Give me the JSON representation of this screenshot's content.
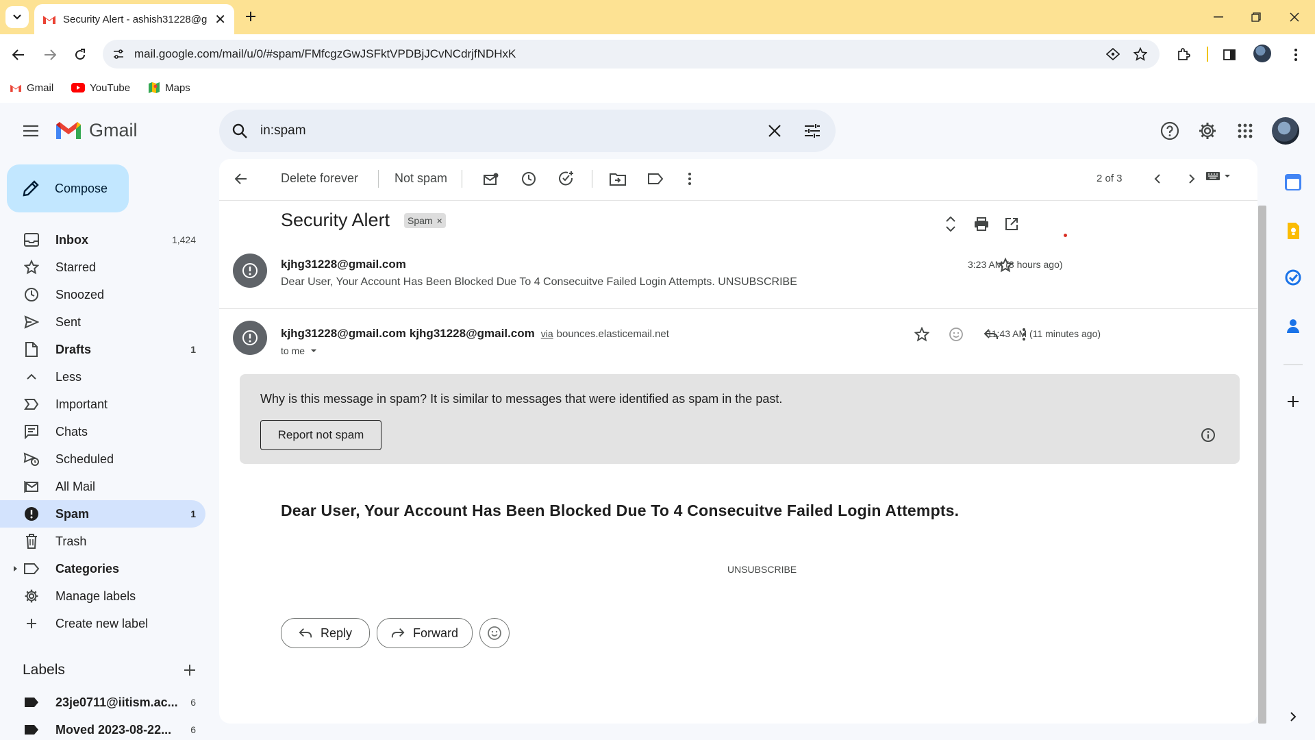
{
  "browser": {
    "tab_title": "Security Alert - ashish31228@g",
    "url": "mail.google.com/mail/u/0/#spam/FMfcgzGwJSFktVPDBjJCvNCdrjfNDHxK",
    "bookmarks": [
      "Gmail",
      "YouTube",
      "Maps"
    ]
  },
  "gmail": {
    "logo_text": "Gmail",
    "search_value": "in:spam",
    "compose_label": "Compose",
    "nav": [
      {
        "label": "Inbox",
        "count": "1,424"
      },
      {
        "label": "Starred",
        "count": ""
      },
      {
        "label": "Snoozed",
        "count": ""
      },
      {
        "label": "Sent",
        "count": ""
      },
      {
        "label": "Drafts",
        "count": "1"
      },
      {
        "label": "Less",
        "count": ""
      },
      {
        "label": "Important",
        "count": ""
      },
      {
        "label": "Chats",
        "count": ""
      },
      {
        "label": "Scheduled",
        "count": ""
      },
      {
        "label": "All Mail",
        "count": ""
      },
      {
        "label": "Spam",
        "count": "1"
      },
      {
        "label": "Trash",
        "count": ""
      },
      {
        "label": "Categories",
        "count": ""
      },
      {
        "label": "Manage labels",
        "count": ""
      },
      {
        "label": "Create new label",
        "count": ""
      }
    ],
    "labels_heading": "Labels",
    "labels": [
      {
        "label": "23je0711@iitism.ac...",
        "count": "6"
      },
      {
        "label": "Moved 2023-08-22...",
        "count": "6"
      }
    ]
  },
  "toolbar": {
    "delete_forever": "Delete forever",
    "not_spam": "Not spam",
    "pagination": "2 of 3"
  },
  "thread": {
    "subject": "Security Alert",
    "spam_chip": "Spam",
    "chip_close": "×",
    "msg1": {
      "sender": "kjhg31228@gmail.com",
      "snippet": "Dear User, Your Account Has Been Blocked Due To 4 Consecuitve Failed Login Attempts. UNSUBSCRIBE",
      "time": "3:23 AM (8 hours ago)"
    },
    "msg2": {
      "sender_name": "kjhg31228@gmail.com",
      "sender_email": "kjhg31228@gmail.com",
      "via": "via",
      "via_domain": "bounces.elasticemail.net",
      "to": "to me",
      "time": "11:43 AM (11 minutes ago)"
    },
    "spam_notice": {
      "question": "Why is this message in spam?",
      "reason": "It is similar to messages that were identified as spam in the past.",
      "report_button": "Report not spam"
    },
    "body_heading": "Dear User, Your Account Has Been Blocked Due To 4 Consecuitve Failed Login Attempts.",
    "unsubscribe": "UNSUBSCRIBE",
    "reply_label": "Reply",
    "forward_label": "Forward"
  },
  "colors": {
    "tabstrip": "#fde293",
    "active_nav": "#d3e3fd",
    "compose": "#c2e7ff",
    "gmail_red": "#ea4335"
  }
}
